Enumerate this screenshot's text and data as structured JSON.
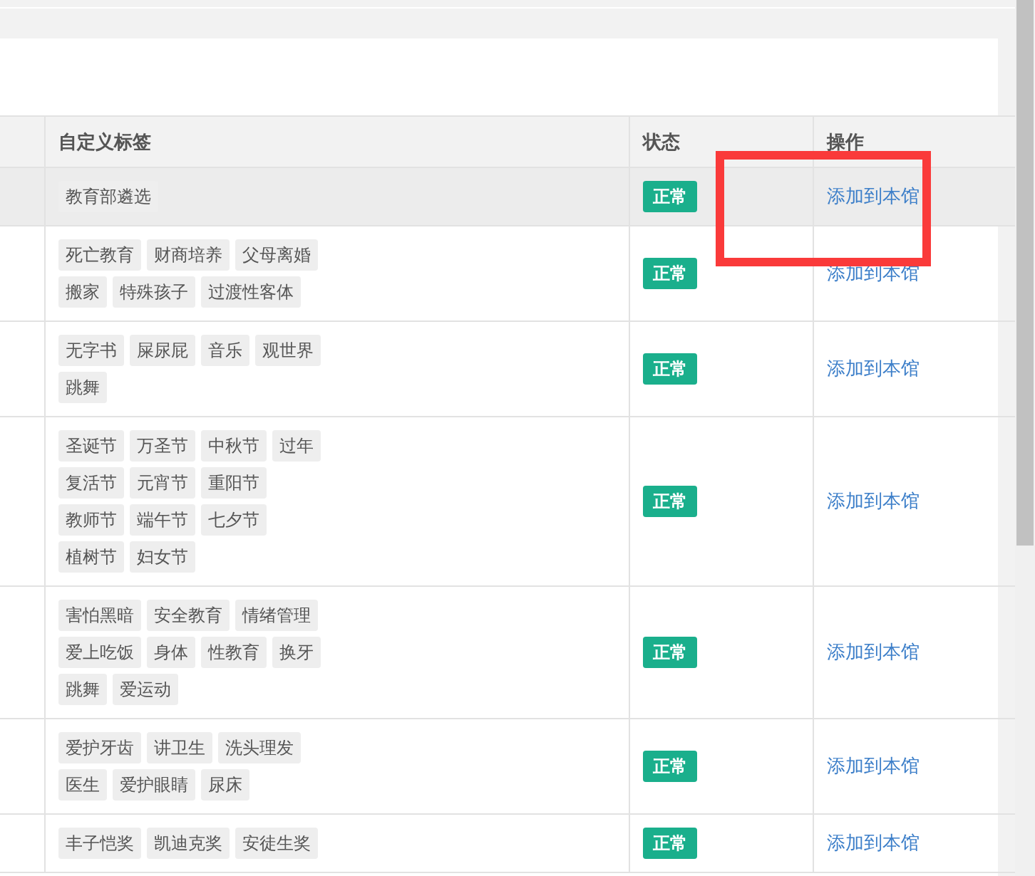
{
  "table": {
    "columns": [
      "自定义标签",
      "状态",
      "操作"
    ],
    "rows": [
      {
        "highlighted": true,
        "tags": [
          "教育部遴选"
        ],
        "status": "正常",
        "action": "添加到本馆"
      },
      {
        "highlighted": false,
        "tags": [
          "死亡教育",
          "财商培养",
          "父母离婚",
          "搬家",
          "特殊孩子",
          "过渡性客体"
        ],
        "status": "正常",
        "action": "添加到本馆"
      },
      {
        "highlighted": false,
        "tags": [
          "无字书",
          "屎尿屁",
          "音乐",
          "观世界",
          "跳舞"
        ],
        "status": "正常",
        "action": "添加到本馆"
      },
      {
        "highlighted": false,
        "tags": [
          "圣诞节",
          "万圣节",
          "中秋节",
          "过年",
          "复活节",
          "元宵节",
          "重阳节",
          "教师节",
          "端午节",
          "七夕节",
          "植树节",
          "妇女节"
        ],
        "status": "正常",
        "action": "添加到本馆"
      },
      {
        "highlighted": false,
        "tags": [
          "害怕黑暗",
          "安全教育",
          "情绪管理",
          "爱上吃饭",
          "身体",
          "性教育",
          "换牙",
          "跳舞",
          "爱运动"
        ],
        "status": "正常",
        "action": "添加到本馆"
      },
      {
        "highlighted": false,
        "tags": [
          "爱护牙齿",
          "讲卫生",
          "洗头理发",
          "医生",
          "爱护眼睛",
          "尿床"
        ],
        "status": "正常",
        "action": "添加到本馆"
      },
      {
        "highlighted": false,
        "tags": [
          "丰子恺奖",
          "凯迪克奖",
          "安徒生奖"
        ],
        "status": "正常",
        "action": "添加到本馆"
      }
    ]
  },
  "annotation": {
    "kind": "highlight_box"
  }
}
